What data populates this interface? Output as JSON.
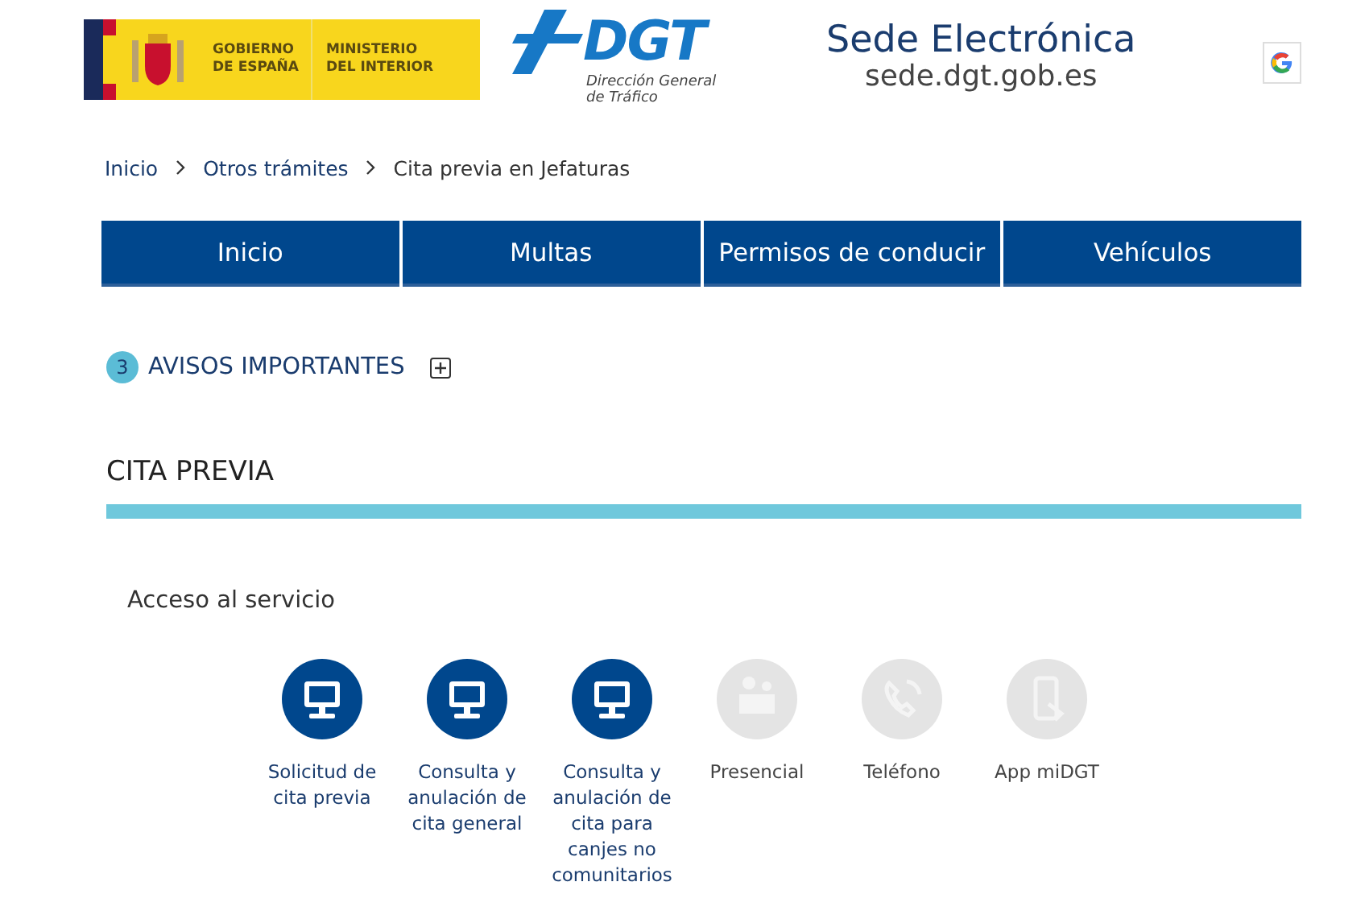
{
  "header": {
    "government_logo": {
      "line_1": "GOBIERNO",
      "line_2": "DE ESPAÑA",
      "ministry_1": "MINISTERIO",
      "ministry_2": "DEL INTERIOR"
    },
    "dgt_logo": {
      "mark": "DGT",
      "subtitle_1": "Dirección General",
      "subtitle_2": "de Tráfico"
    },
    "site_title": "Sede Electrónica",
    "site_url": "sede.dgt.gob.es"
  },
  "breadcrumb": [
    {
      "label": "Inicio"
    },
    {
      "label": "Otros trámites"
    },
    {
      "label": "Cita previa en Jefaturas"
    }
  ],
  "nav_tabs": [
    {
      "label": "Inicio"
    },
    {
      "label": "Multas"
    },
    {
      "label": "Permisos de conducir"
    },
    {
      "label": "Vehículos"
    }
  ],
  "notices": {
    "count": "3",
    "label": "AVISOS IMPORTANTES",
    "expanded": false
  },
  "section_title": "CITA PREVIA",
  "access_title": "Acceso al servicio",
  "services": [
    {
      "kind": "computer",
      "label": "Solicitud de cita previa",
      "disabled": false
    },
    {
      "kind": "computer",
      "label": "Consulta y anulación de cita general",
      "disabled": false
    },
    {
      "kind": "computer",
      "label": "Consulta y anulación de cita para canjes no comunitarios",
      "disabled": false
    },
    {
      "kind": "office",
      "label": "Presencial",
      "disabled": true
    },
    {
      "kind": "phone",
      "label": "Teléfono",
      "disabled": true
    },
    {
      "kind": "app",
      "label": "App miDGT",
      "disabled": true
    }
  ]
}
